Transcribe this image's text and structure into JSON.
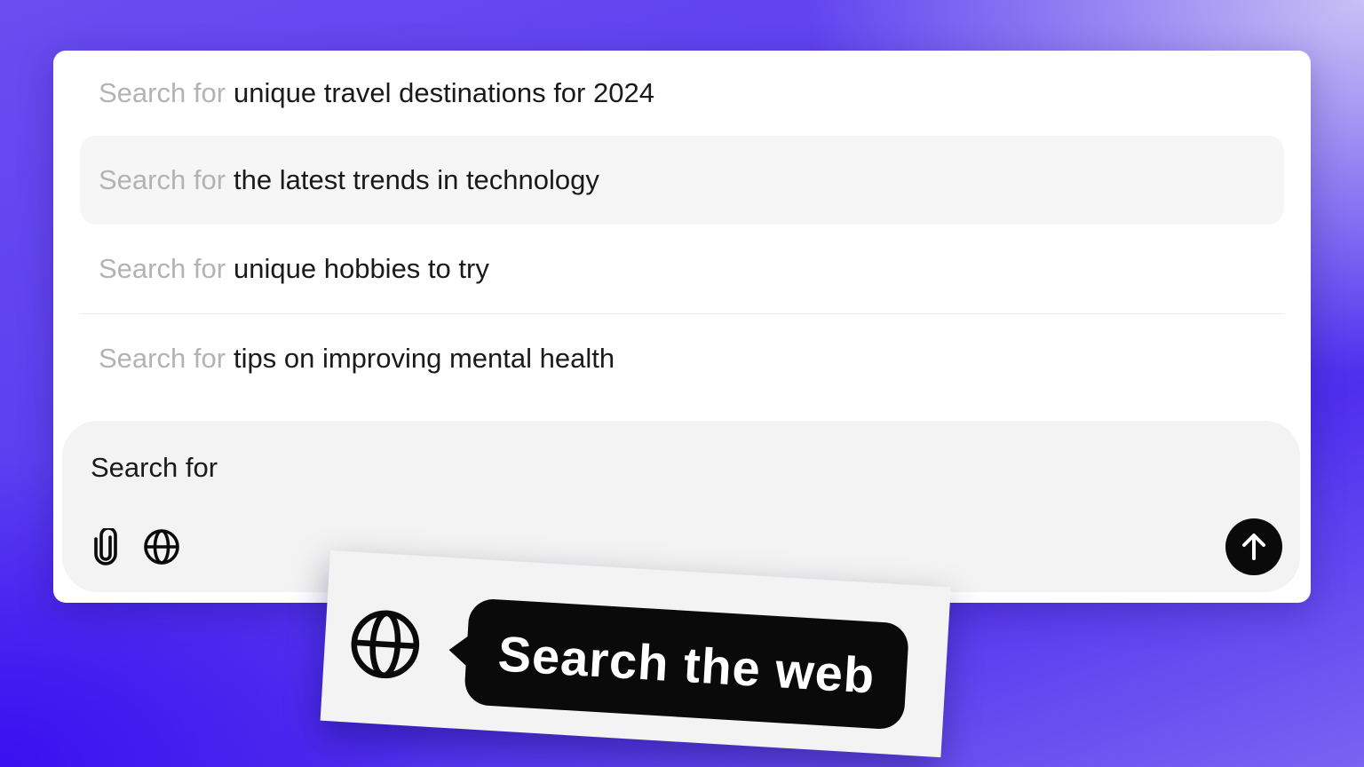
{
  "suggestions": {
    "prefix": "Search for",
    "items": [
      {
        "text": "unique travel destinations for 2024"
      },
      {
        "text": "the latest trends in technology"
      },
      {
        "text": "unique hobbies to try"
      },
      {
        "text": "tips on improving mental health"
      }
    ]
  },
  "composer": {
    "input_value": "Search for",
    "attach_icon": "paperclip-icon",
    "web_icon": "globe-icon",
    "send_icon": "arrow-up-icon"
  },
  "callout": {
    "icon": "globe-icon",
    "tooltip_text": "Search the web"
  },
  "colors": {
    "send_button": "#0a0a0a",
    "tooltip_bg": "#0a0a0a",
    "prefix_text": "#b3b3b3",
    "highlight_row": "#f6f6f6"
  }
}
